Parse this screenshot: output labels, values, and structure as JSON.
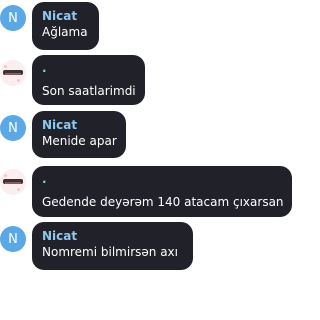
{
  "avatars": {
    "nicat_initial": "N",
    "nicat_color": "#5aa9e6"
  },
  "messages": [
    {
      "sender": "Nicat",
      "text": "Ağlama"
    },
    {
      "sender": ".",
      "text": "Son saatlarimdi"
    },
    {
      "sender": "Nicat",
      "text": "Menide apar"
    },
    {
      "sender": ".",
      "text": "Gedende deyərəm 140 atacam çıxarsan"
    },
    {
      "sender": "Nicat",
      "text": "Nomremi bilmirsən axı"
    }
  ]
}
